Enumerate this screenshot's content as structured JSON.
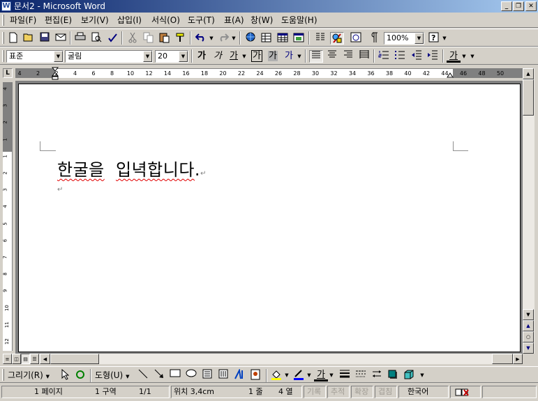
{
  "window": {
    "title": "문서2 - Microsoft Word",
    "controls": {
      "minimize": "_",
      "restore": "❐",
      "close": "✕"
    }
  },
  "menu": [
    "파일(F)",
    "편집(E)",
    "보기(V)",
    "삽입(I)",
    "서식(O)",
    "도구(T)",
    "표(A)",
    "창(W)",
    "도움말(H)"
  ],
  "standard_toolbar": {
    "icons": [
      "new-icon",
      "open-icon",
      "save-icon",
      "email-icon",
      "print-icon",
      "print-preview-icon",
      "spelling-icon",
      "cut-icon",
      "copy-icon",
      "paste-icon",
      "format-painter-icon",
      "undo-icon",
      "redo-icon",
      "hyperlink-icon",
      "tables-borders-icon",
      "insert-table-icon",
      "insert-excel-icon",
      "columns-icon",
      "drawing-icon",
      "document-map-icon",
      "show-hide-icon",
      "help-icon"
    ],
    "zoom": "100%"
  },
  "formatting_toolbar": {
    "style": "표준",
    "font": "굴림",
    "size": "20",
    "bold": "가",
    "italic": "가",
    "underline": "가",
    "char_border": "가",
    "char_shading": "가",
    "char_scale": "가",
    "font_color": "가"
  },
  "ruler": {
    "ticks": [
      "4",
      "2",
      "2",
      "4",
      "6",
      "8",
      "10",
      "12",
      "14",
      "16",
      "18",
      "20",
      "22",
      "24",
      "26",
      "28",
      "30",
      "32",
      "34",
      "36",
      "38",
      "40",
      "42",
      "44",
      "46",
      "48",
      "50"
    ],
    "vticks": [
      "4",
      "3",
      "2",
      "1",
      "1",
      "2",
      "3",
      "4",
      "5",
      "6",
      "7",
      "8",
      "9",
      "10",
      "11",
      "12"
    ]
  },
  "document": {
    "text_word1": "한굴을",
    "text_word2": "입녁합니다",
    "text_end": ".",
    "para_mark": "↵"
  },
  "drawing_toolbar": {
    "draw_menu": "그리기(R)",
    "autoshapes_menu": "도형(U)",
    "font_color": "가"
  },
  "status": {
    "page": "1 페이지",
    "section": "1 구역",
    "pages": "1/1",
    "position": "위치 3,4cm",
    "line": "1 줄",
    "column": "4 열",
    "rec": "기록",
    "trk": "추적",
    "ext": "확장",
    "ovr": "겹침",
    "language": "한국어"
  }
}
